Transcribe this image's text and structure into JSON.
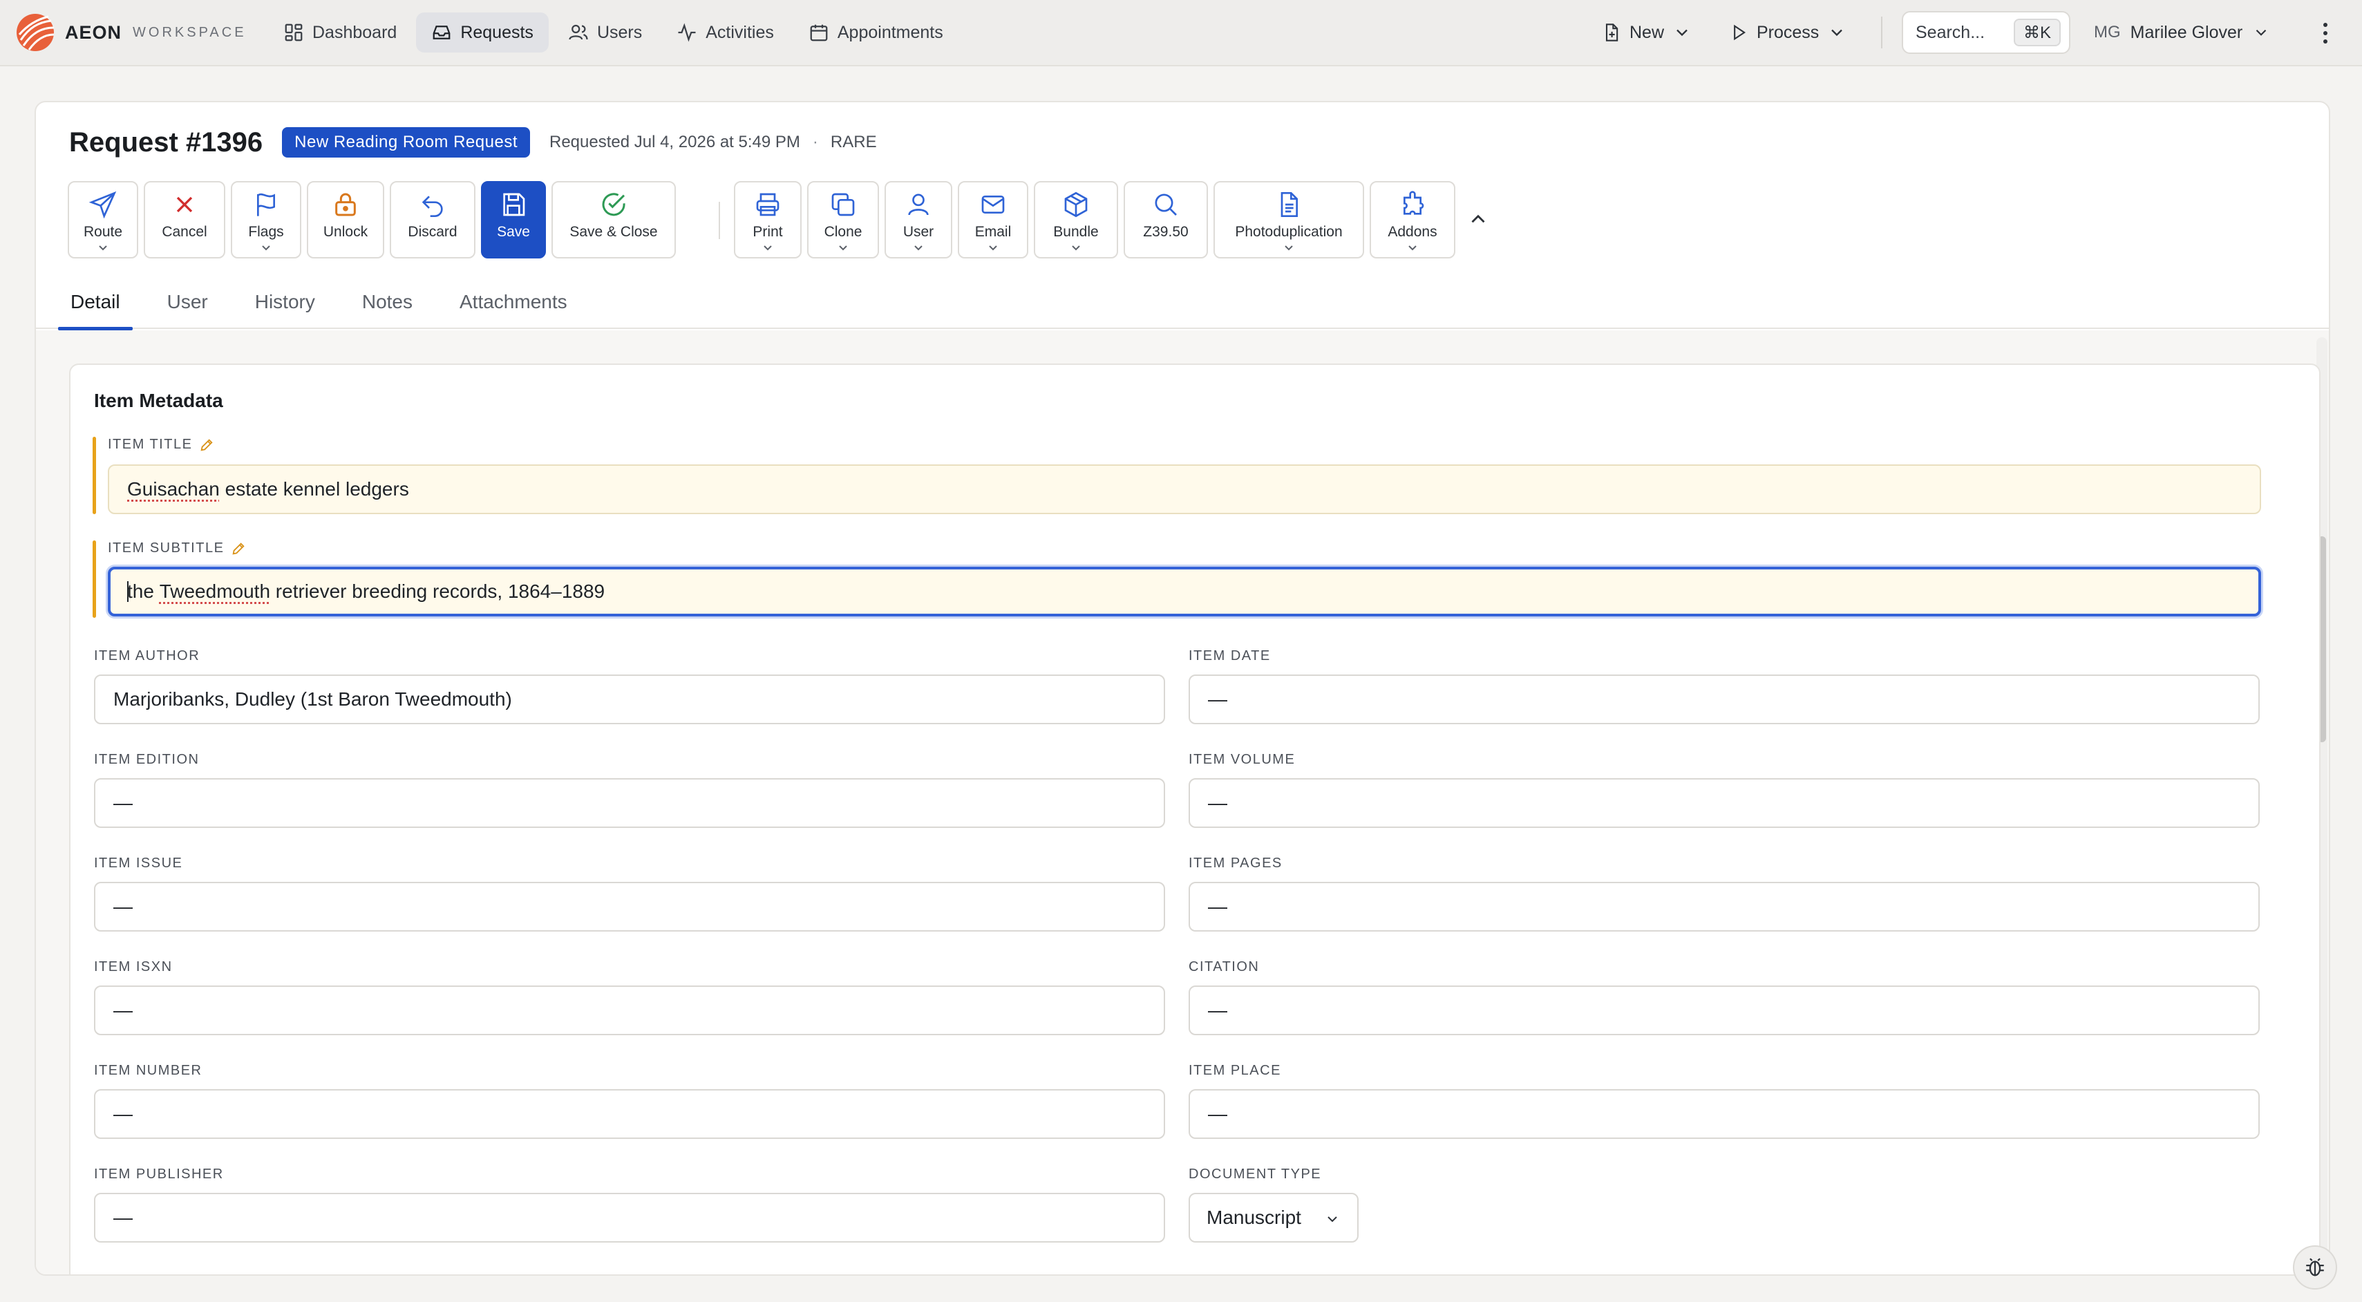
{
  "brand": {
    "name": "AEON",
    "sub": "WORKSPACE"
  },
  "nav": {
    "items": [
      {
        "label": "Dashboard",
        "icon": "dashboard-grid-icon"
      },
      {
        "label": "Requests",
        "icon": "inbox-icon",
        "active": true
      },
      {
        "label": "Users",
        "icon": "users-icon"
      },
      {
        "label": "Activities",
        "icon": "activity-pulse-icon"
      },
      {
        "label": "Appointments",
        "icon": "calendar-icon"
      }
    ]
  },
  "topbar": {
    "new_label": "New",
    "process_label": "Process",
    "search_placeholder": "Search...",
    "search_shortcut": "⌘K",
    "user_initials": "MG",
    "user_name": "Marilee Glover"
  },
  "request": {
    "title": "Request #1396",
    "badge": "New Reading Room Request",
    "requested": "Requested Jul 4, 2026 at 5:49 PM",
    "separator": "·",
    "department": "RARE"
  },
  "toolbar": {
    "route": "Route",
    "cancel": "Cancel",
    "flags": "Flags",
    "unlock": "Unlock",
    "discard": "Discard",
    "save": "Save",
    "save_close": "Save & Close",
    "print": "Print",
    "clone": "Clone",
    "user": "User",
    "email": "Email",
    "bundle": "Bundle",
    "z3950": "Z39.50",
    "photoduplication": "Photoduplication",
    "addons": "Addons"
  },
  "tabs": {
    "detail": "Detail",
    "user": "User",
    "history": "History",
    "notes": "Notes",
    "attachments": "Attachments"
  },
  "section": {
    "title": "Item Metadata",
    "item_title": {
      "label": "ITEM TITLE",
      "value_prefix": "Guisachan",
      "value_rest": " estate kennel ledgers"
    },
    "item_subtitle": {
      "label": "ITEM SUBTITLE",
      "value_a": "the ",
      "value_b": "Tweedmouth",
      "value_c": " retriever breeding records, 1864–1889"
    },
    "item_author": {
      "label": "ITEM AUTHOR",
      "value": "Marjoribanks, Dudley (1st Baron Tweedmouth)"
    },
    "item_date": {
      "label": "ITEM DATE",
      "value": "—"
    },
    "item_edition": {
      "label": "ITEM EDITION",
      "value": "—"
    },
    "item_volume": {
      "label": "ITEM VOLUME",
      "value": "—"
    },
    "item_issue": {
      "label": "ITEM ISSUE",
      "value": "—"
    },
    "item_pages": {
      "label": "ITEM PAGES",
      "value": "—"
    },
    "item_isxn": {
      "label": "ITEM ISXN",
      "value": "—"
    },
    "citation": {
      "label": "CITATION",
      "value": "—"
    },
    "item_number": {
      "label": "ITEM NUMBER",
      "value": "—"
    },
    "item_place": {
      "label": "ITEM PLACE",
      "value": "—"
    },
    "item_publisher": {
      "label": "ITEM PUBLISHER",
      "value": "—"
    },
    "document_type": {
      "label": "DOCUMENT TYPE",
      "value": "Manuscript"
    }
  },
  "colors": {
    "accent": "#1d4fc4",
    "edited_bar": "#e8a21a",
    "edited_bg": "#fffaeb",
    "cancel_red": "#d12c2c",
    "unlock_orange": "#d9781d",
    "save_close_green": "#2e9a55",
    "brand_orange": "#e8603a"
  }
}
